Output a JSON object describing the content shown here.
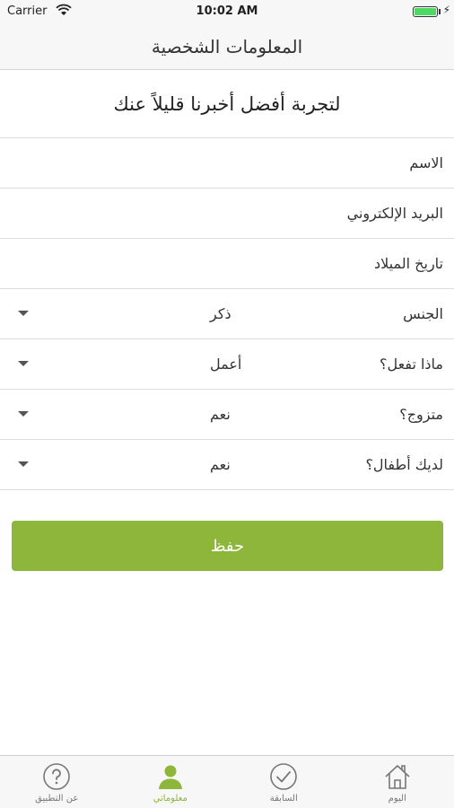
{
  "status_bar": {
    "carrier": "Carrier",
    "time": "10:02 AM"
  },
  "nav": {
    "title": "المعلومات الشخصية"
  },
  "intro": {
    "text": "لتجربة أفضل أخبرنا قليلاً عنك"
  },
  "fields": {
    "name": {
      "label": "الاسم"
    },
    "email": {
      "label": "البريد الإلكتروني"
    },
    "birthdate": {
      "label": "تاريخ الميلاد"
    },
    "gender": {
      "label": "الجنس",
      "value": "ذكر"
    },
    "occupation": {
      "label": "ماذا تفعل؟",
      "value": "أعمل"
    },
    "married": {
      "label": "متزوج؟",
      "value": "نعم"
    },
    "children": {
      "label": "لديك أطفال؟",
      "value": "نعم"
    }
  },
  "save_button": {
    "label": "حفظ"
  },
  "tabs": [
    {
      "label": "عن التطبيق",
      "icon": "question-icon",
      "active": false
    },
    {
      "label": "معلوماتي",
      "icon": "person-icon",
      "active": true
    },
    {
      "label": "السابقة",
      "icon": "check-icon",
      "active": false
    },
    {
      "label": "اليوم",
      "icon": "home-icon",
      "active": false
    }
  ],
  "colors": {
    "accent": "#8db63a",
    "battery": "#4cd964"
  }
}
